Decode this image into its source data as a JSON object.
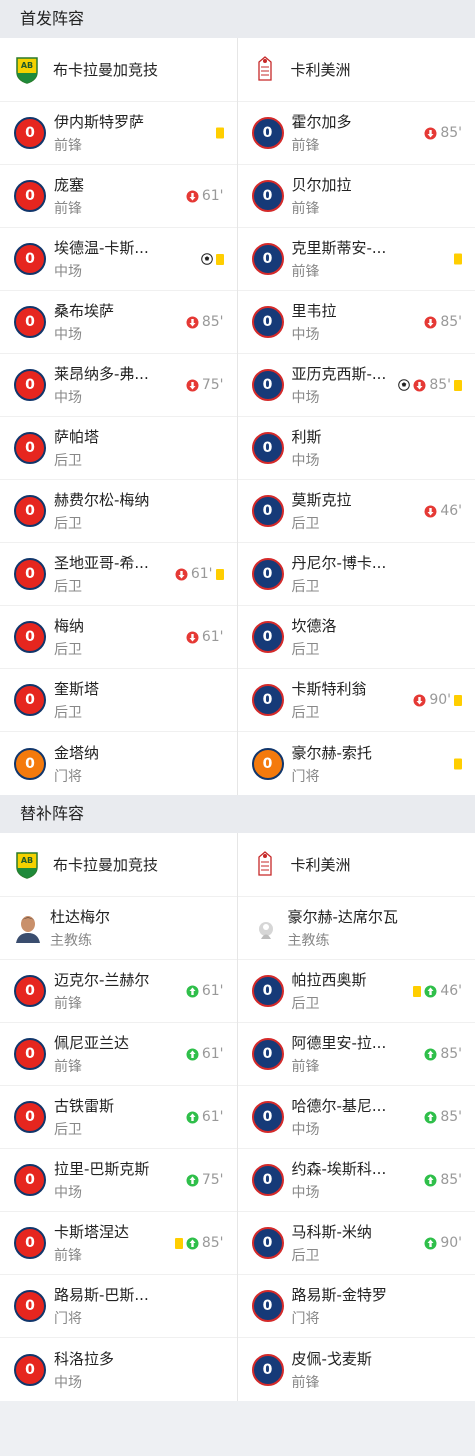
{
  "starting": {
    "title": "首发阵容",
    "left_team": "布卡拉曼加竞技",
    "right_team": "卡利美洲",
    "left": [
      {
        "num": "0",
        "name": "伊内斯特罗萨",
        "pos": "前锋",
        "color": "red",
        "events": [
          {
            "type": "yellow"
          }
        ]
      },
      {
        "num": "0",
        "name": "庞塞",
        "pos": "前锋",
        "color": "red",
        "events": [
          {
            "type": "sub_out",
            "min": "61'"
          }
        ]
      },
      {
        "num": "0",
        "name": "埃德温-卡斯...",
        "pos": "中场",
        "color": "red",
        "events": [
          {
            "type": "goal"
          },
          {
            "type": "yellow"
          }
        ]
      },
      {
        "num": "0",
        "name": "桑布埃萨",
        "pos": "中场",
        "color": "red",
        "events": [
          {
            "type": "sub_out",
            "min": "85'"
          }
        ]
      },
      {
        "num": "0",
        "name": "莱昂纳多-弗...",
        "pos": "中场",
        "color": "red",
        "events": [
          {
            "type": "sub_out",
            "min": "75'"
          }
        ]
      },
      {
        "num": "0",
        "name": "萨帕塔",
        "pos": "后卫",
        "color": "red",
        "events": []
      },
      {
        "num": "0",
        "name": "赫费尔松-梅纳",
        "pos": "后卫",
        "color": "red",
        "events": []
      },
      {
        "num": "0",
        "name": "圣地亚哥-希...",
        "pos": "后卫",
        "color": "red",
        "events": [
          {
            "type": "sub_out",
            "min": "61'"
          },
          {
            "type": "yellow"
          }
        ]
      },
      {
        "num": "0",
        "name": "梅纳",
        "pos": "后卫",
        "color": "red",
        "events": [
          {
            "type": "sub_out",
            "min": "61'"
          }
        ]
      },
      {
        "num": "0",
        "name": "奎斯塔",
        "pos": "后卫",
        "color": "red",
        "events": []
      },
      {
        "num": "0",
        "name": "金塔纳",
        "pos": "门将",
        "color": "orange",
        "events": []
      }
    ],
    "right": [
      {
        "num": "0",
        "name": "霍尔加多",
        "pos": "前锋",
        "color": "blue",
        "events": [
          {
            "type": "sub_out",
            "min": "85'"
          }
        ]
      },
      {
        "num": "0",
        "name": "贝尔加拉",
        "pos": "前锋",
        "color": "blue",
        "events": []
      },
      {
        "num": "0",
        "name": "克里斯蒂安-...",
        "pos": "前锋",
        "color": "blue",
        "events": [
          {
            "type": "yellow"
          }
        ]
      },
      {
        "num": "0",
        "name": "里韦拉",
        "pos": "中场",
        "color": "blue",
        "events": [
          {
            "type": "sub_out",
            "min": "85'"
          }
        ]
      },
      {
        "num": "0",
        "name": "亚历克西斯-...",
        "pos": "中场",
        "color": "blue",
        "events": [
          {
            "type": "goal"
          },
          {
            "type": "sub_out",
            "min": "85'"
          },
          {
            "type": "yellow"
          }
        ]
      },
      {
        "num": "0",
        "name": "利斯",
        "pos": "中场",
        "color": "blue",
        "events": []
      },
      {
        "num": "0",
        "name": "莫斯克拉",
        "pos": "后卫",
        "color": "blue",
        "events": [
          {
            "type": "sub_out",
            "min": "46'"
          }
        ]
      },
      {
        "num": "0",
        "name": "丹尼尔-博卡...",
        "pos": "后卫",
        "color": "blue",
        "events": []
      },
      {
        "num": "0",
        "name": "坎德洛",
        "pos": "后卫",
        "color": "blue",
        "events": []
      },
      {
        "num": "0",
        "name": "卡斯特利翁",
        "pos": "后卫",
        "color": "blue",
        "events": [
          {
            "type": "sub_out",
            "min": "90'"
          },
          {
            "type": "yellow"
          }
        ]
      },
      {
        "num": "0",
        "name": "豪尔赫-索托",
        "pos": "门将",
        "color": "orange",
        "events": [
          {
            "type": "yellow"
          }
        ]
      }
    ]
  },
  "subs": {
    "title": "替补阵容",
    "left_team": "布卡拉曼加竞技",
    "right_team": "卡利美洲",
    "left_coach": {
      "name": "杜达梅尔",
      "role": "主教练"
    },
    "right_coach": {
      "name": "豪尔赫-达席尔瓦",
      "role": "主教练"
    },
    "left": [
      {
        "num": "0",
        "name": "迈克尔-兰赫尔",
        "pos": "前锋",
        "color": "red",
        "events": [
          {
            "type": "sub_in",
            "min": "61'"
          }
        ]
      },
      {
        "num": "0",
        "name": "佩尼亚兰达",
        "pos": "前锋",
        "color": "red",
        "events": [
          {
            "type": "sub_in",
            "min": "61'"
          }
        ]
      },
      {
        "num": "0",
        "name": "古铁雷斯",
        "pos": "后卫",
        "color": "red",
        "events": [
          {
            "type": "sub_in",
            "min": "61'"
          }
        ]
      },
      {
        "num": "0",
        "name": "拉里-巴斯克斯",
        "pos": "中场",
        "color": "red",
        "events": [
          {
            "type": "sub_in",
            "min": "75'"
          }
        ]
      },
      {
        "num": "0",
        "name": "卡斯塔涅达",
        "pos": "前锋",
        "color": "red",
        "events": [
          {
            "type": "yellow"
          },
          {
            "type": "sub_in",
            "min": "85'"
          }
        ]
      },
      {
        "num": "0",
        "name": "路易斯-巴斯...",
        "pos": "门将",
        "color": "red",
        "events": []
      },
      {
        "num": "0",
        "name": "科洛拉多",
        "pos": "中场",
        "color": "red",
        "events": []
      }
    ],
    "right": [
      {
        "num": "0",
        "name": "帕拉西奥斯",
        "pos": "后卫",
        "color": "blue",
        "events": [
          {
            "type": "yellow"
          },
          {
            "type": "sub_in",
            "min": "46'"
          }
        ]
      },
      {
        "num": "0",
        "name": "阿德里安-拉...",
        "pos": "前锋",
        "color": "blue",
        "events": [
          {
            "type": "sub_in",
            "min": "85'"
          }
        ]
      },
      {
        "num": "0",
        "name": "哈德尔-基尼...",
        "pos": "中场",
        "color": "blue",
        "events": [
          {
            "type": "sub_in",
            "min": "85'"
          }
        ]
      },
      {
        "num": "0",
        "name": "约森-埃斯科...",
        "pos": "中场",
        "color": "blue",
        "events": [
          {
            "type": "sub_in",
            "min": "85'"
          }
        ]
      },
      {
        "num": "0",
        "name": "马科斯-米纳",
        "pos": "后卫",
        "color": "blue",
        "events": [
          {
            "type": "sub_in",
            "min": "90'"
          }
        ]
      },
      {
        "num": "0",
        "name": "路易斯-金特罗",
        "pos": "门将",
        "color": "blue",
        "events": []
      },
      {
        "num": "0",
        "name": "皮佩-戈麦斯",
        "pos": "前锋",
        "color": "blue",
        "events": []
      }
    ]
  },
  "colors": {
    "home_number": "#e6261f",
    "away_number": "#163a78",
    "goalkeeper": "#f47a0d",
    "yellow_card": "#ffce00",
    "sub_out": "#e53935",
    "sub_in": "#2fbf4a"
  }
}
